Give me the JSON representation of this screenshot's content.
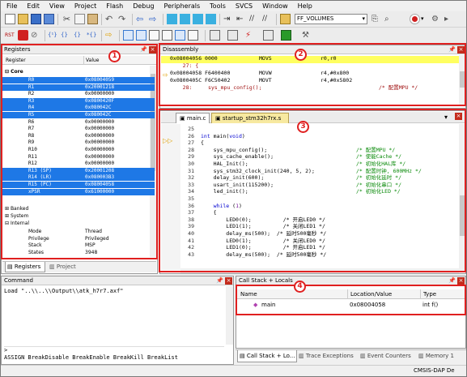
{
  "menu": [
    "File",
    "Edit",
    "View",
    "Project",
    "Flash",
    "Debug",
    "Peripherals",
    "Tools",
    "SVCS",
    "Window",
    "Help"
  ],
  "toolbar": {
    "target_combo": "FF_VOLUMES"
  },
  "registers": {
    "title": "Registers",
    "col_register": "Register",
    "col_value": "Value",
    "core_label": "Core",
    "rows": [
      {
        "name": "R0",
        "value": "0x08004059",
        "sel": true
      },
      {
        "name": "R1",
        "value": "0x20001218",
        "sel": true
      },
      {
        "name": "R2",
        "value": "0x00000000",
        "sel": false
      },
      {
        "name": "R3",
        "value": "0x0800420F",
        "sel": true
      },
      {
        "name": "R4",
        "value": "0x080042C",
        "sel": true
      },
      {
        "name": "R5",
        "value": "0x080042C",
        "sel": true
      },
      {
        "name": "R6",
        "value": "0x00000000",
        "sel": false
      },
      {
        "name": "R7",
        "value": "0x00000000",
        "sel": false
      },
      {
        "name": "R8",
        "value": "0x00000000",
        "sel": false
      },
      {
        "name": "R9",
        "value": "0x00000000",
        "sel": false
      },
      {
        "name": "R10",
        "value": "0x00000000",
        "sel": false
      },
      {
        "name": "R11",
        "value": "0x00000000",
        "sel": false
      },
      {
        "name": "R12",
        "value": "0x00000000",
        "sel": false
      },
      {
        "name": "R13 (SP)",
        "value": "0x20001208",
        "sel": true
      },
      {
        "name": "R14 (LR)",
        "value": "0x080003B3",
        "sel": true
      },
      {
        "name": "R15 (PC)",
        "value": "0x08004058",
        "sel": true
      },
      {
        "name": "xPSR",
        "value": "0x61000000",
        "sel": true
      }
    ],
    "banked": "Banked",
    "system": "System",
    "internal": "Internal",
    "internal_rows": [
      {
        "name": "Mode",
        "value": "Thread"
      },
      {
        "name": "Privilege",
        "value": "Privileged"
      },
      {
        "name": "Stack",
        "value": "MSP"
      },
      {
        "name": "States",
        "value": "3948"
      }
    ],
    "tab_registers": "Registers",
    "tab_project": "Project"
  },
  "disassembly": {
    "title": "Disassembly",
    "lines": [
      {
        "addr": "0x08004056 0000",
        "op": "MOVS",
        "args": "r0,r0",
        "hl": true
      },
      {
        "addr": "    27: {",
        "op": "",
        "args": "",
        "hl": false
      },
      {
        "addr": "0x08004058 F6400400",
        "op": "MOVW",
        "args": "r4,#0x800",
        "hl": false
      },
      {
        "addr": "0x0800405C F6C50402",
        "op": "MOVT",
        "args": "r4,#0x5802",
        "hl": false
      },
      {
        "addr": "    28:     sys_mpu_config();",
        "op": "",
        "args": "/* 配置MPU */",
        "hl": false
      }
    ]
  },
  "editor": {
    "tabs": [
      "main.c",
      "startup_stm32h7rx.s"
    ],
    "lines": [
      {
        "n": "25",
        "code": "",
        "cm": ""
      },
      {
        "n": "26",
        "code": "int main(void)",
        "cm": ""
      },
      {
        "n": "27",
        "code": "{",
        "cm": ""
      },
      {
        "n": "28",
        "code": "    sys_mpu_config();",
        "cm": "/* 配置MPU */"
      },
      {
        "n": "29",
        "code": "    sys_cache_enable();",
        "cm": "/* 使能Cache */"
      },
      {
        "n": "30",
        "code": "    HAL_Init();",
        "cm": "/* 初始化HAL库 */"
      },
      {
        "n": "31",
        "code": "    sys_stm32_clock_init(240, 5, 2);",
        "cm": "/* 配置时钟, 600MHz */"
      },
      {
        "n": "32",
        "code": "    delay_init(600);",
        "cm": "/* 初始化延时 */"
      },
      {
        "n": "33",
        "code": "    usart_init(115200);",
        "cm": "/* 初始化串口 */"
      },
      {
        "n": "34",
        "code": "    led_init();",
        "cm": "/* 初始化LED */"
      },
      {
        "n": "35",
        "code": "",
        "cm": ""
      },
      {
        "n": "36",
        "code": "    while (1)",
        "cm": ""
      },
      {
        "n": "37",
        "code": "    {",
        "cm": ""
      },
      {
        "n": "38",
        "code": "        LED0(0);          /* 开启LED0 */",
        "cm": ""
      },
      {
        "n": "39",
        "code": "        LED1(1);          /* 关闭LED1 */",
        "cm": ""
      },
      {
        "n": "40",
        "code": "        delay_ms(500);  /* 延时500毫秒 */",
        "cm": ""
      },
      {
        "n": "41",
        "code": "        LED0(1);          /* 关闭LED0 */",
        "cm": ""
      },
      {
        "n": "42",
        "code": "        LED1(0);          /* 开启LED1 */",
        "cm": ""
      },
      {
        "n": "43",
        "code": "        delay_ms(500);  /* 延时500毫秒 */",
        "cm": ""
      }
    ]
  },
  "command": {
    "title": "Command",
    "output": "Load \"..\\\\..\\\\Output\\\\atk_h7r7.axf\"",
    "prompt": ">",
    "hint": "ASSIGN BreakDisable BreakEnable BreakKill BreakList"
  },
  "callstack": {
    "title": "Call Stack + Locals",
    "col_name": "Name",
    "col_loc": "Location/Value",
    "col_type": "Type",
    "rows": [
      {
        "name": "main",
        "loc": "0x08004058",
        "type": "int f()"
      }
    ]
  },
  "bottom_tabs": [
    "Call Stack + Lo...",
    "Trace Exceptions",
    "Event Counters",
    "Memory 1"
  ],
  "status": "CMSIS-DAP De",
  "badges": [
    "1",
    "2",
    "3",
    "4"
  ]
}
